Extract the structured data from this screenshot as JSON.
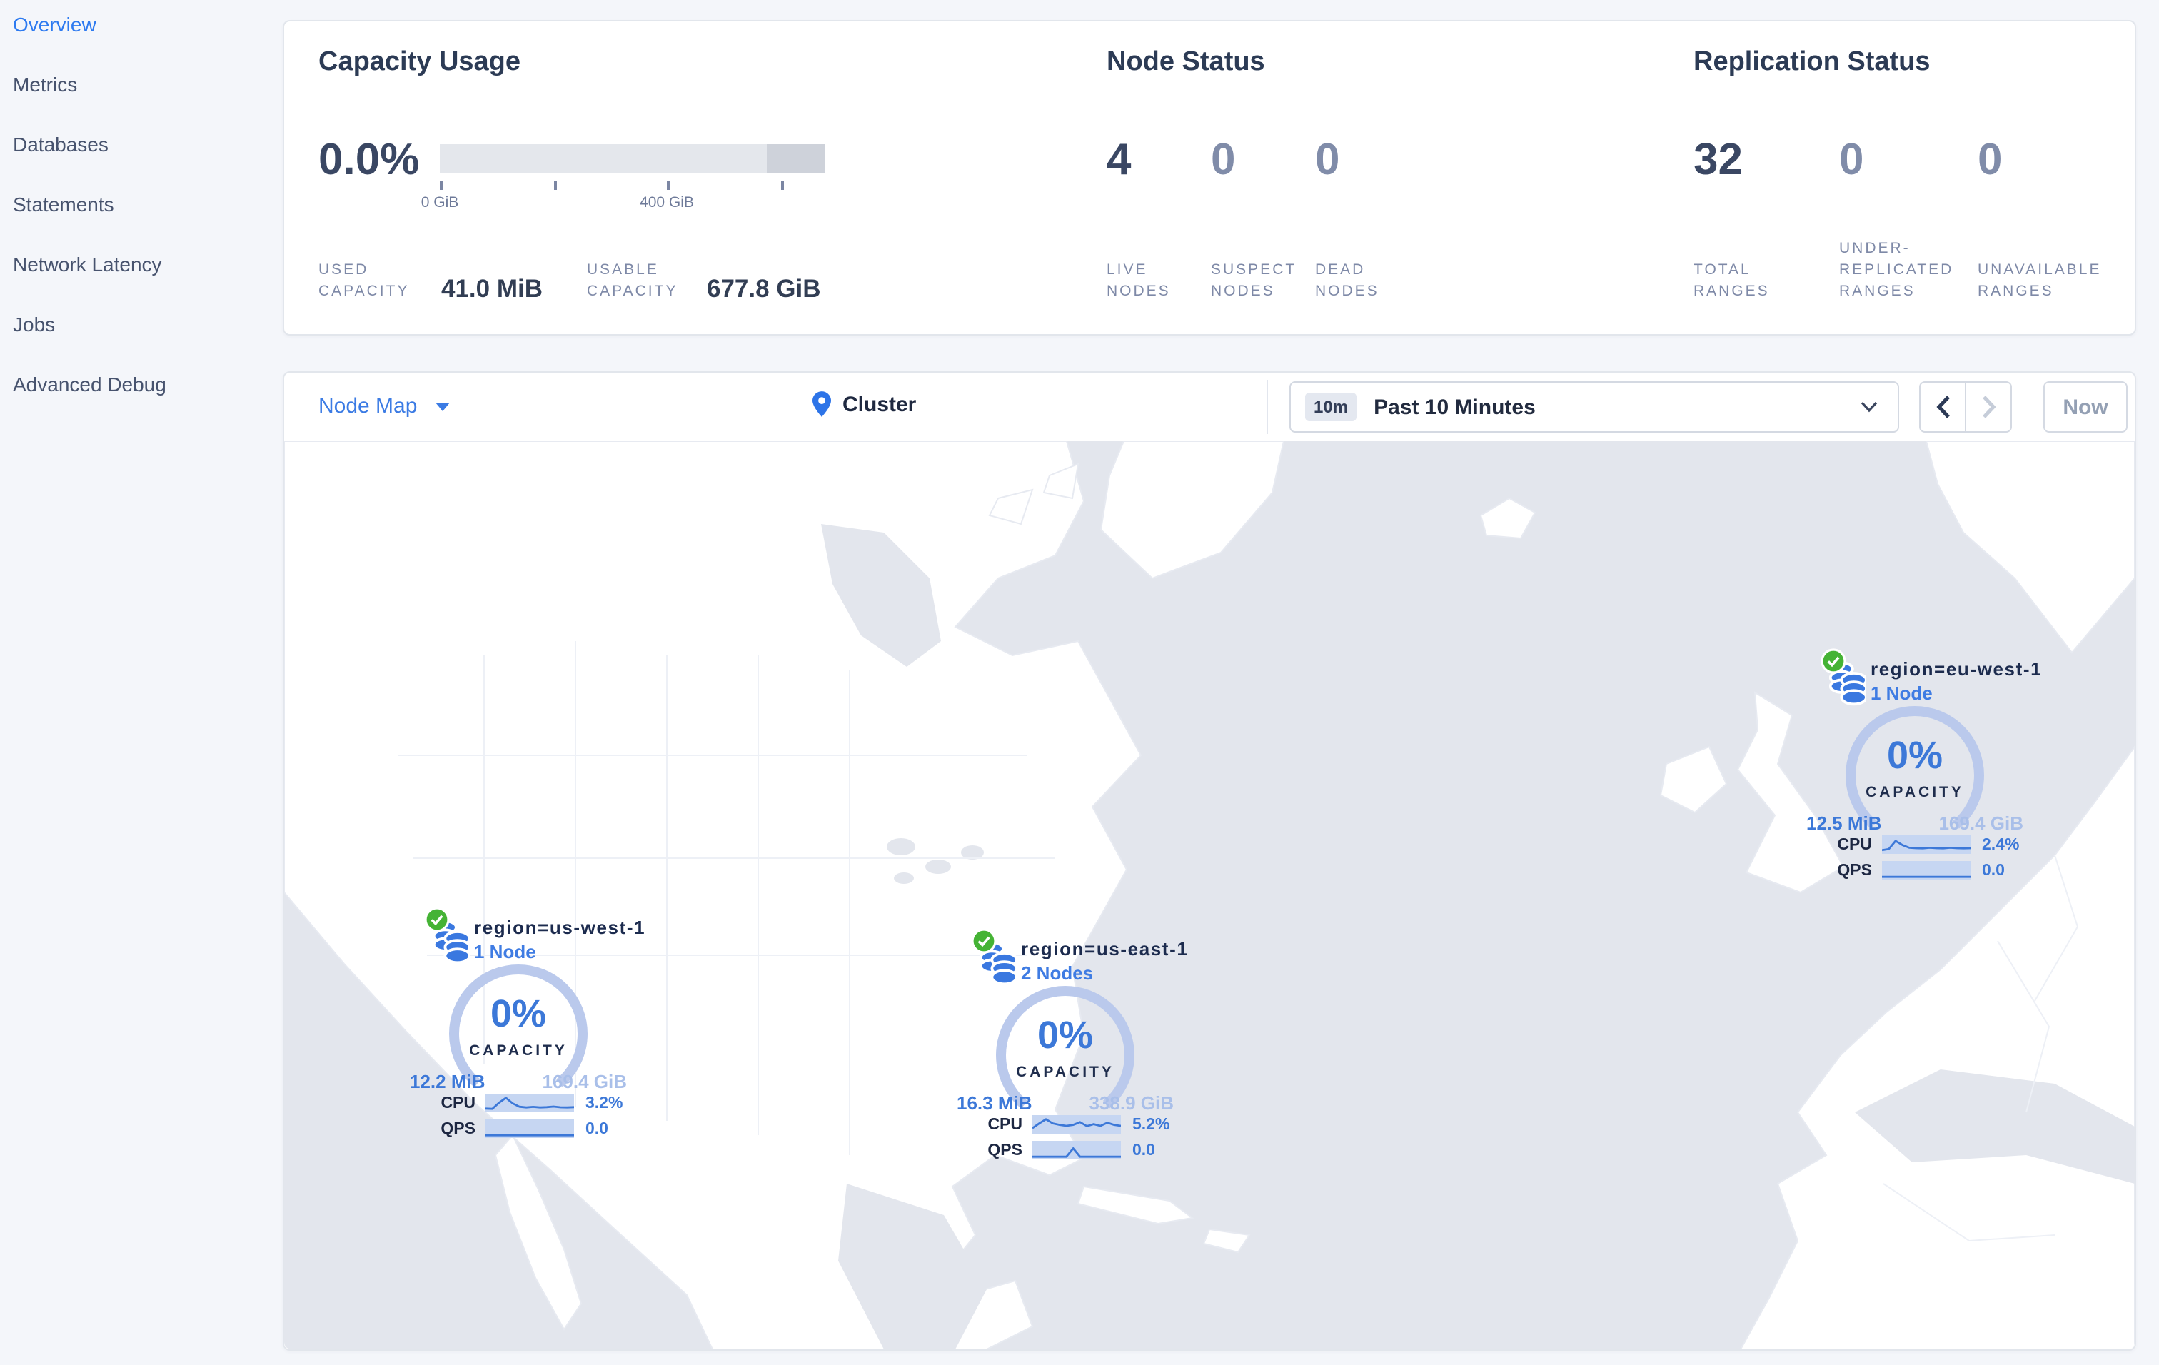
{
  "sidebar": {
    "items": [
      {
        "label": "Overview",
        "active": true
      },
      {
        "label": "Metrics"
      },
      {
        "label": "Databases"
      },
      {
        "label": "Statements"
      },
      {
        "label": "Network Latency"
      },
      {
        "label": "Jobs"
      },
      {
        "label": "Advanced Debug"
      }
    ]
  },
  "summary": {
    "capacity": {
      "title": "Capacity Usage",
      "percent": "0.0%",
      "axis": {
        "tick_start": "0 GiB",
        "tick_mid": "400 GiB"
      },
      "used": {
        "label": "USED CAPACITY",
        "value": "41.0 MiB"
      },
      "usable": {
        "label": "USABLE CAPACITY",
        "value": "677.8 GiB"
      }
    },
    "nodes": {
      "title": "Node Status",
      "stats": [
        {
          "value": "4",
          "label": "LIVE NODES"
        },
        {
          "value": "0",
          "label": "SUSPECT NODES"
        },
        {
          "value": "0",
          "label": "DEAD NODES"
        }
      ]
    },
    "replication": {
      "title": "Replication Status",
      "stats": [
        {
          "value": "32",
          "label": "TOTAL RANGES"
        },
        {
          "value": "0",
          "label": "UNDER-REPLICATED RANGES"
        },
        {
          "value": "0",
          "label": "UNAVAILABLE RANGES"
        }
      ]
    }
  },
  "toolbar": {
    "view": "Node Map",
    "breadcrumb": "Cluster",
    "time_badge": "10m",
    "time_label": "Past 10 Minutes",
    "now_label": "Now"
  },
  "colors": {
    "accent_blue": "#3c78d8",
    "link_blue": "#2d7af0",
    "gauge_ring": "#bac9ec",
    "ocean": "#e3e6ed",
    "land": "#ffffff",
    "status_green": "#45b335"
  },
  "map": {
    "regions": [
      {
        "name": "region=us-west-1",
        "nodes": "1 Node",
        "percent": "0%",
        "capacity_label": "CAPACITY",
        "used": "12.2 MiB",
        "capacity": "169.4 GiB",
        "cpu_label": "CPU",
        "cpu_value": "3.2%",
        "qps_label": "QPS",
        "qps_value": "0.0",
        "cpu_spark": [
          1.2,
          1.0,
          5.5,
          9.0,
          5.0,
          2.5,
          2.0,
          2.4,
          2.0,
          2.2,
          2.6,
          2.1,
          2.0,
          2.2
        ],
        "qps_spark": [
          0.4,
          0.4,
          0.4,
          0.4,
          0.4,
          0.4,
          0.4,
          0.4,
          0.4,
          0.4,
          0.4,
          0.4,
          0.4,
          0.4
        ]
      },
      {
        "name": "region=us-east-1",
        "nodes": "2 Nodes",
        "percent": "0%",
        "capacity_label": "CAPACITY",
        "used": "16.3 MiB",
        "capacity": "338.9 GiB",
        "cpu_label": "CPU",
        "cpu_value": "5.2%",
        "qps_label": "QPS",
        "qps_value": "0.0",
        "cpu_spark": [
          2.5,
          6.0,
          9.0,
          6.0,
          5.0,
          4.2,
          5.0,
          7.0,
          4.0,
          5.5,
          4.2,
          6.5,
          5.0,
          4.2
        ],
        "qps_spark": [
          0.4,
          0.4,
          0.4,
          0.4,
          0.4,
          0.4,
          6.5,
          0.4,
          0.4,
          0.4,
          0.4,
          0.4,
          0.4,
          0.4
        ]
      },
      {
        "name": "region=eu-west-1",
        "nodes": "1 Node",
        "percent": "0%",
        "capacity_label": "CAPACITY",
        "used": "12.5 MiB",
        "capacity": "169.4 GiB",
        "cpu_label": "CPU",
        "cpu_value": "2.4%",
        "qps_label": "QPS",
        "qps_value": "0.0",
        "cpu_spark": [
          1.2,
          2.0,
          8.0,
          5.0,
          3.0,
          2.6,
          2.5,
          3.0,
          2.6,
          2.5,
          3.0,
          2.6,
          2.5,
          2.6
        ],
        "qps_spark": [
          0.4,
          0.4,
          0.4,
          0.4,
          0.4,
          0.4,
          0.4,
          0.4,
          0.4,
          0.4,
          0.4,
          0.4,
          0.4,
          0.4
        ]
      }
    ]
  }
}
